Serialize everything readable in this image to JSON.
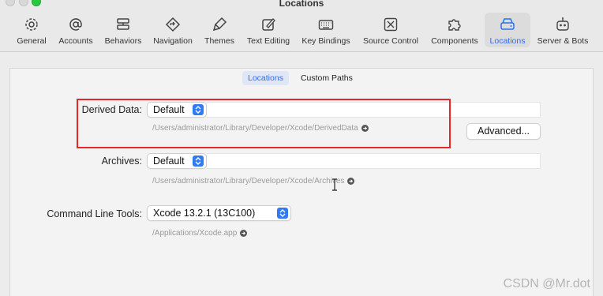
{
  "window": {
    "title": "Locations"
  },
  "toolbar": {
    "items": [
      {
        "label": "General",
        "icon": "gear-icon"
      },
      {
        "label": "Accounts",
        "icon": "at-icon"
      },
      {
        "label": "Behaviors",
        "icon": "behaviors-icon"
      },
      {
        "label": "Navigation",
        "icon": "navigation-icon"
      },
      {
        "label": "Themes",
        "icon": "brush-icon"
      },
      {
        "label": "Text Editing",
        "icon": "edit-icon"
      },
      {
        "label": "Key Bindings",
        "icon": "keyboard-icon"
      },
      {
        "label": "Source Control",
        "icon": "source-control-icon"
      },
      {
        "label": "Components",
        "icon": "puzzle-icon"
      },
      {
        "label": "Locations",
        "icon": "drive-icon",
        "selected": true
      },
      {
        "label": "Server & Bots",
        "icon": "robot-icon"
      }
    ]
  },
  "tabs": {
    "locations": "Locations",
    "custom_paths": "Custom Paths",
    "selected": "Locations"
  },
  "derived_data": {
    "label": "Derived Data:",
    "value": "Default",
    "path": "/Users/administrator/Library/Developer/Xcode/DerivedData",
    "advanced_label": "Advanced..."
  },
  "archives": {
    "label": "Archives:",
    "value": "Default",
    "path": "/Users/administrator/Library/Developer/Xcode/Archives"
  },
  "command_line_tools": {
    "label": "Command Line Tools:",
    "value": "Xcode 13.2.1 (13C100)",
    "path": "/Applications/Xcode.app"
  },
  "watermark": "CSDN @Mr.dot",
  "colors": {
    "accent": "#2a6ef2",
    "highlight_box": "#e5262b",
    "stepper": "#2f7bf6"
  }
}
